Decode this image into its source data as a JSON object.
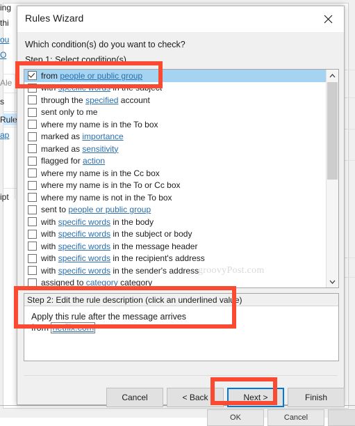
{
  "background": {
    "fragments": [
      {
        "text": "ing"
      },
      {
        "text": "thi"
      },
      {
        "text": "ou"
      },
      {
        "text": "O"
      },
      {
        "text": "Ale"
      },
      {
        "text": "s"
      },
      {
        "text": "Rule"
      },
      {
        "text": "ap"
      },
      {
        "text": "ipt"
      }
    ],
    "buttons": [
      {
        "label": "OK"
      },
      {
        "label": "Cancel"
      },
      {
        "label": ""
      }
    ]
  },
  "dialog": {
    "title": "Rules Wizard",
    "close_icon": "close-icon",
    "question": "Which condition(s) do you want to check?",
    "step1_label": "Step 1: Select condition(s)",
    "conditions": [
      {
        "checked": true,
        "selected": true,
        "parts": [
          {
            "t": "from ",
            "lk": false
          },
          {
            "t": "people or public group",
            "lk": true
          }
        ]
      },
      {
        "checked": false,
        "selected": false,
        "parts": [
          {
            "t": "with ",
            "lk": false
          },
          {
            "t": "specific words",
            "lk": true
          },
          {
            "t": " in the subject",
            "lk": false
          }
        ]
      },
      {
        "checked": false,
        "selected": false,
        "parts": [
          {
            "t": "through the ",
            "lk": false
          },
          {
            "t": "specified",
            "lk": true
          },
          {
            "t": " account",
            "lk": false
          }
        ]
      },
      {
        "checked": false,
        "selected": false,
        "parts": [
          {
            "t": "sent only to me",
            "lk": false
          }
        ]
      },
      {
        "checked": false,
        "selected": false,
        "parts": [
          {
            "t": "where my name is in the To box",
            "lk": false
          }
        ]
      },
      {
        "checked": false,
        "selected": false,
        "parts": [
          {
            "t": "marked as ",
            "lk": false
          },
          {
            "t": "importance",
            "lk": true
          }
        ]
      },
      {
        "checked": false,
        "selected": false,
        "parts": [
          {
            "t": "marked as ",
            "lk": false
          },
          {
            "t": "sensitivity",
            "lk": true
          }
        ]
      },
      {
        "checked": false,
        "selected": false,
        "parts": [
          {
            "t": "flagged for ",
            "lk": false
          },
          {
            "t": "action",
            "lk": true
          }
        ]
      },
      {
        "checked": false,
        "selected": false,
        "parts": [
          {
            "t": "where my name is in the Cc box",
            "lk": false
          }
        ]
      },
      {
        "checked": false,
        "selected": false,
        "parts": [
          {
            "t": "where my name is in the To or Cc box",
            "lk": false
          }
        ]
      },
      {
        "checked": false,
        "selected": false,
        "parts": [
          {
            "t": "where my name is not in the To box",
            "lk": false
          }
        ]
      },
      {
        "checked": false,
        "selected": false,
        "parts": [
          {
            "t": "sent to ",
            "lk": false
          },
          {
            "t": "people or public group",
            "lk": true
          }
        ]
      },
      {
        "checked": false,
        "selected": false,
        "parts": [
          {
            "t": "with ",
            "lk": false
          },
          {
            "t": "specific words",
            "lk": true
          },
          {
            "t": " in the body",
            "lk": false
          }
        ]
      },
      {
        "checked": false,
        "selected": false,
        "parts": [
          {
            "t": "with ",
            "lk": false
          },
          {
            "t": "specific words",
            "lk": true
          },
          {
            "t": " in the subject or body",
            "lk": false
          }
        ]
      },
      {
        "checked": false,
        "selected": false,
        "parts": [
          {
            "t": "with ",
            "lk": false
          },
          {
            "t": "specific words",
            "lk": true
          },
          {
            "t": " in the message header",
            "lk": false
          }
        ]
      },
      {
        "checked": false,
        "selected": false,
        "parts": [
          {
            "t": "with ",
            "lk": false
          },
          {
            "t": "specific words",
            "lk": true
          },
          {
            "t": " in the recipient's address",
            "lk": false
          }
        ]
      },
      {
        "checked": false,
        "selected": false,
        "parts": [
          {
            "t": "with ",
            "lk": false
          },
          {
            "t": "specific words",
            "lk": true
          },
          {
            "t": " in the sender's address",
            "lk": false
          }
        ]
      },
      {
        "checked": false,
        "selected": false,
        "parts": [
          {
            "t": "assigned to ",
            "lk": false
          },
          {
            "t": "category",
            "lk": true
          },
          {
            "t": " category",
            "lk": false
          }
        ]
      }
    ],
    "scrollbar": {
      "up_icon": "chevron-up-icon",
      "down_icon": "chevron-down-icon"
    },
    "step2_header": "Step 2: Edit the rule description (click an underlined value)",
    "step2_line1": "Apply this rule after the message arrives",
    "step2_line2_prefix": "from ",
    "step2_value": "netflix.com",
    "buttons": {
      "cancel": "Cancel",
      "back": "< Back",
      "next": "Next >",
      "finish": "Finish"
    }
  },
  "watermark": "groovyPost.com",
  "annotations": {
    "highlight_color": "#fa4b32",
    "boxes": [
      {
        "name": "selected-condition-highlight"
      },
      {
        "name": "step2-description-highlight"
      },
      {
        "name": "next-button-highlight"
      }
    ]
  }
}
